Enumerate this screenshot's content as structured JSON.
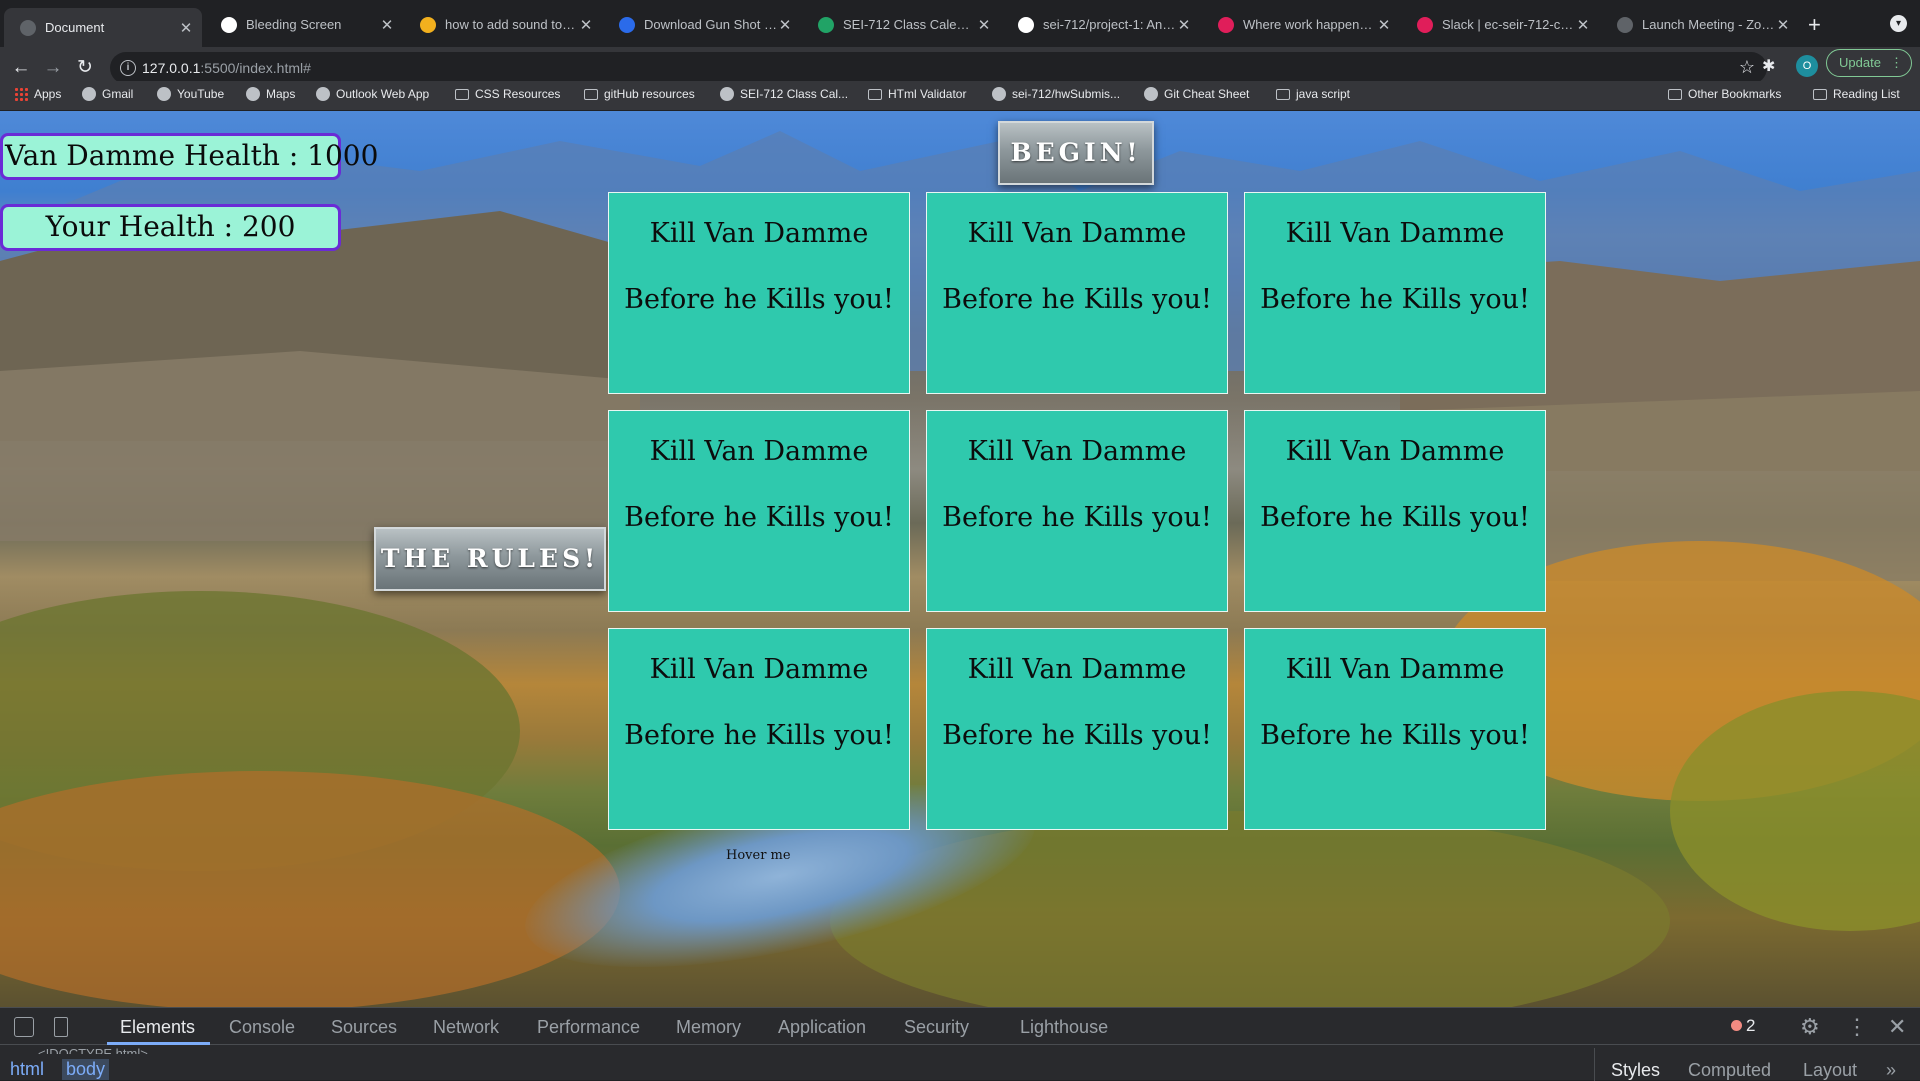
{
  "browser": {
    "tabs": [
      {
        "title": "Document",
        "active": true,
        "icon": "globe-icon",
        "color": "#5f6368"
      },
      {
        "title": "Bleeding Screen",
        "icon": "codepen-icon",
        "color": "#ffffff"
      },
      {
        "title": "how to add sound to click",
        "icon": "bing-icon",
        "color": "#f2b01e"
      },
      {
        "title": "Download Gun Shot Single",
        "icon": "v-icon",
        "color": "#2b6bea"
      },
      {
        "title": "SEI-712 Class Calendar",
        "icon": "sheets-icon",
        "color": "#21a366"
      },
      {
        "title": "sei-712/project-1: An intro",
        "icon": "github-icon",
        "color": "#ffffff"
      },
      {
        "title": "Where work happens | Slack",
        "icon": "slack-icon",
        "color": "#e01e5a"
      },
      {
        "title": "Slack | ec-seir-712-class",
        "icon": "slack-icon",
        "color": "#e01e5a"
      },
      {
        "title": "Launch Meeting - Zoom",
        "icon": "globe-icon",
        "color": "#5f6368"
      }
    ],
    "url_host": "127.0.0.1",
    "url_rest": ":5500/index.html#",
    "update_label": "Update",
    "profile_initial": "O"
  },
  "bookmarks": [
    {
      "label": "Apps",
      "icon": "apps-grid-icon"
    },
    {
      "label": "Gmail",
      "icon": "gmail-icon"
    },
    {
      "label": "YouTube",
      "icon": "youtube-icon"
    },
    {
      "label": "Maps",
      "icon": "maps-icon"
    },
    {
      "label": "Outlook Web App",
      "icon": "outlook-icon"
    },
    {
      "label": "CSS Resources",
      "icon": "folder-icon"
    },
    {
      "label": "gitHub resources",
      "icon": "folder-icon"
    },
    {
      "label": "SEI-712 Class Cal...",
      "icon": "sheets-icon"
    },
    {
      "label": "HTml Validator",
      "icon": "folder-icon"
    },
    {
      "label": "sei-712/hwSubmis...",
      "icon": "github-icon"
    },
    {
      "label": "Git Cheat Sheet",
      "icon": "cheatsheet-icon"
    },
    {
      "label": "java script",
      "icon": "folder-icon"
    }
  ],
  "bookmarks_right": [
    {
      "label": "Other Bookmarks",
      "icon": "folder-icon"
    },
    {
      "label": "Reading List",
      "icon": "reading-list-icon"
    }
  ],
  "game": {
    "vandamme_health": "Van Damme Health : 1000",
    "your_health": "Your Health : 200",
    "begin_label": "BEGIN!",
    "rules_label": "THE RULES!",
    "card_line1": "Kill Van Damme",
    "card_line2": "Before he Kills you!",
    "hover_text": "Hover me",
    "card_count": 9
  },
  "devtools": {
    "tabs": [
      "Elements",
      "Console",
      "Sources",
      "Network",
      "Performance",
      "Memory",
      "Application",
      "Security",
      "Lighthouse"
    ],
    "active_tab": "Elements",
    "error_count": "2",
    "breadcrumbs": [
      "html",
      "body"
    ],
    "doctype": "<!DOCTYPE html>",
    "side_tabs": [
      "Styles",
      "Computed",
      "Layout"
    ]
  }
}
